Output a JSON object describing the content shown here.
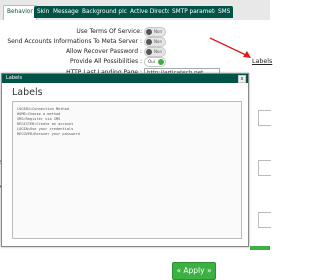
{
  "tabs": [
    {
      "label": "Behavior",
      "active": true
    },
    {
      "label": "Skin"
    },
    {
      "label": "Messages"
    },
    {
      "label": "Background picture"
    },
    {
      "label": "Active Directory"
    },
    {
      "label": "SMTP parameters"
    },
    {
      "label": "SMS"
    }
  ],
  "form": {
    "rows": [
      {
        "label": "Use Terms Of Service:",
        "toggle": "Non",
        "on": false
      },
      {
        "label": "Send Accounts Informations To Meta Server :",
        "toggle": "Non",
        "on": false
      },
      {
        "label": "Allow Recover Password :",
        "toggle": "Non",
        "on": false
      },
      {
        "label": "Provide All Possibilities :",
        "toggle": "Oui",
        "on": true
      }
    ],
    "landing_label": "HTTP Last Landing Page :",
    "landing_value": "http://articatech.net",
    "labels_link": "Labels"
  },
  "modal": {
    "titlebar": "Labels",
    "close": "x",
    "heading": "Labels",
    "lines": [
      "LOGIN1=Connection Method",
      "HOME=Choose a method",
      "SMS=Register via SMS",
      "REGISTER=Create an account",
      "LOGIN=Use your credentials",
      "RECOVER=Recover your password"
    ],
    "apply_label": "« Apply »"
  },
  "fragments": {
    "left_s": "S",
    "left_e": "e"
  },
  "colors": {
    "brand": "#005447",
    "accent_green": "#3cb043"
  }
}
